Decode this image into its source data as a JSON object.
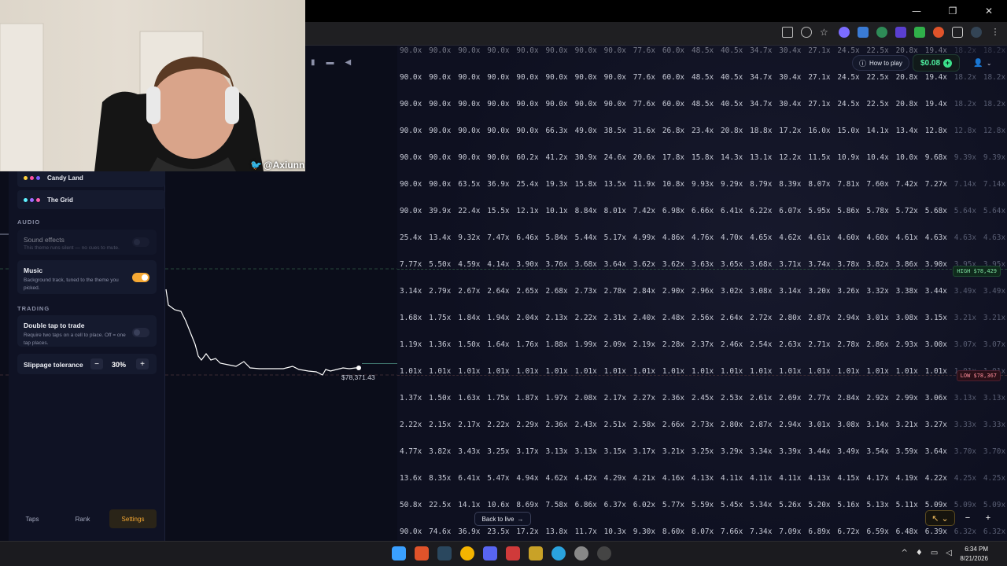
{
  "window": {
    "minimize": "—",
    "maximize": "❐",
    "close": "✕"
  },
  "header": {
    "how_to_play": "How to play",
    "balance": "$0.08",
    "balance_plus": "+"
  },
  "chart": {
    "price_label": "$78,371.43",
    "high_tag": "HIGH $78,429",
    "low_tag": "LOW $78,367"
  },
  "grid_rows": [
    [
      "90.0x",
      "90.0x",
      "90.0x",
      "90.0x",
      "90.0x",
      "90.0x",
      "90.0x",
      "90.0x",
      "77.6x",
      "60.0x",
      "48.5x",
      "40.5x",
      "34.7x",
      "30.4x",
      "27.1x",
      "24.5x",
      "22.5x",
      "20.8x",
      "19.4x",
      "18.2x",
      "18.2x",
      "18.2x"
    ],
    [
      "90.0x",
      "90.0x",
      "90.0x",
      "90.0x",
      "90.0x",
      "90.0x",
      "90.0x",
      "90.0x",
      "77.6x",
      "60.0x",
      "48.5x",
      "40.5x",
      "34.7x",
      "30.4x",
      "27.1x",
      "24.5x",
      "22.5x",
      "20.8x",
      "19.4x",
      "18.2x",
      "18.2x",
      "18.2x"
    ],
    [
      "90.0x",
      "90.0x",
      "90.0x",
      "90.0x",
      "90.0x",
      "90.0x",
      "90.0x",
      "90.0x",
      "77.6x",
      "60.0x",
      "48.5x",
      "40.5x",
      "34.7x",
      "30.4x",
      "27.1x",
      "24.5x",
      "22.5x",
      "20.8x",
      "19.4x",
      "18.2x",
      "18.2x",
      "18.2x"
    ],
    [
      "90.0x",
      "90.0x",
      "90.0x",
      "90.0x",
      "90.0x",
      "66.3x",
      "49.0x",
      "38.5x",
      "31.6x",
      "26.8x",
      "23.4x",
      "20.8x",
      "18.8x",
      "17.2x",
      "16.0x",
      "15.0x",
      "14.1x",
      "13.4x",
      "12.8x",
      "12.8x",
      "12.8x",
      "12.8x"
    ],
    [
      "90.0x",
      "90.0x",
      "90.0x",
      "90.0x",
      "60.2x",
      "41.2x",
      "30.9x",
      "24.6x",
      "20.6x",
      "17.8x",
      "15.8x",
      "14.3x",
      "13.1x",
      "12.2x",
      "11.5x",
      "10.9x",
      "10.4x",
      "10.0x",
      "9.68x",
      "9.39x",
      "9.39x",
      "9.39x"
    ],
    [
      "90.0x",
      "90.0x",
      "63.5x",
      "36.9x",
      "25.4x",
      "19.3x",
      "15.8x",
      "13.5x",
      "11.9x",
      "10.8x",
      "9.93x",
      "9.29x",
      "8.79x",
      "8.39x",
      "8.07x",
      "7.81x",
      "7.60x",
      "7.42x",
      "7.27x",
      "7.14x",
      "7.14x",
      "7.14x"
    ],
    [
      "90.0x",
      "39.9x",
      "22.4x",
      "15.5x",
      "12.1x",
      "10.1x",
      "8.84x",
      "8.01x",
      "7.42x",
      "6.98x",
      "6.66x",
      "6.41x",
      "6.22x",
      "6.07x",
      "5.95x",
      "5.86x",
      "5.78x",
      "5.72x",
      "5.68x",
      "5.64x",
      "5.64x",
      "5.64x"
    ],
    [
      "25.4x",
      "13.4x",
      "9.32x",
      "7.47x",
      "6.46x",
      "5.84x",
      "5.44x",
      "5.17x",
      "4.99x",
      "4.86x",
      "4.76x",
      "4.70x",
      "4.65x",
      "4.62x",
      "4.61x",
      "4.60x",
      "4.60x",
      "4.61x",
      "4.63x",
      "4.63x",
      "4.63x",
      "4.63x"
    ],
    [
      "7.77x",
      "5.50x",
      "4.59x",
      "4.14x",
      "3.90x",
      "3.76x",
      "3.68x",
      "3.64x",
      "3.62x",
      "3.62x",
      "3.63x",
      "3.65x",
      "3.68x",
      "3.71x",
      "3.74x",
      "3.78x",
      "3.82x",
      "3.86x",
      "3.90x",
      "3.95x",
      "3.95x",
      "3.95x"
    ],
    [
      "3.14x",
      "2.79x",
      "2.67x",
      "2.64x",
      "2.65x",
      "2.68x",
      "2.73x",
      "2.78x",
      "2.84x",
      "2.90x",
      "2.96x",
      "3.02x",
      "3.08x",
      "3.14x",
      "3.20x",
      "3.26x",
      "3.32x",
      "3.38x",
      "3.44x",
      "3.49x",
      "3.49x",
      "3.49x"
    ],
    [
      "1.68x",
      "1.75x",
      "1.84x",
      "1.94x",
      "2.04x",
      "2.13x",
      "2.22x",
      "2.31x",
      "2.40x",
      "2.48x",
      "2.56x",
      "2.64x",
      "2.72x",
      "2.80x",
      "2.87x",
      "2.94x",
      "3.01x",
      "3.08x",
      "3.15x",
      "3.21x",
      "3.21x",
      "3.21x"
    ],
    [
      "1.19x",
      "1.36x",
      "1.50x",
      "1.64x",
      "1.76x",
      "1.88x",
      "1.99x",
      "2.09x",
      "2.19x",
      "2.28x",
      "2.37x",
      "2.46x",
      "2.54x",
      "2.63x",
      "2.71x",
      "2.78x",
      "2.86x",
      "2.93x",
      "3.00x",
      "3.07x",
      "3.07x",
      "3.07x"
    ],
    [
      "1.01x",
      "1.01x",
      "1.01x",
      "1.01x",
      "1.01x",
      "1.01x",
      "1.01x",
      "1.01x",
      "1.01x",
      "1.01x",
      "1.01x",
      "1.01x",
      "1.01x",
      "1.01x",
      "1.01x",
      "1.01x",
      "1.01x",
      "1.01x",
      "1.01x",
      "1.01x",
      "1.01x",
      ""
    ],
    [
      "1.37x",
      "1.50x",
      "1.63x",
      "1.75x",
      "1.87x",
      "1.97x",
      "2.08x",
      "2.17x",
      "2.27x",
      "2.36x",
      "2.45x",
      "2.53x",
      "2.61x",
      "2.69x",
      "2.77x",
      "2.84x",
      "2.92x",
      "2.99x",
      "3.06x",
      "3.13x",
      "3.13x",
      "3.13x"
    ],
    [
      "2.22x",
      "2.15x",
      "2.17x",
      "2.22x",
      "2.29x",
      "2.36x",
      "2.43x",
      "2.51x",
      "2.58x",
      "2.66x",
      "2.73x",
      "2.80x",
      "2.87x",
      "2.94x",
      "3.01x",
      "3.08x",
      "3.14x",
      "3.21x",
      "3.27x",
      "3.33x",
      "3.33x",
      "3.33x"
    ],
    [
      "4.77x",
      "3.82x",
      "3.43x",
      "3.25x",
      "3.17x",
      "3.13x",
      "3.13x",
      "3.15x",
      "3.17x",
      "3.21x",
      "3.25x",
      "3.29x",
      "3.34x",
      "3.39x",
      "3.44x",
      "3.49x",
      "3.54x",
      "3.59x",
      "3.64x",
      "3.70x",
      "3.70x",
      "3.70x"
    ],
    [
      "13.6x",
      "8.35x",
      "6.41x",
      "5.47x",
      "4.94x",
      "4.62x",
      "4.42x",
      "4.29x",
      "4.21x",
      "4.16x",
      "4.13x",
      "4.11x",
      "4.11x",
      "4.11x",
      "4.13x",
      "4.15x",
      "4.17x",
      "4.19x",
      "4.22x",
      "4.25x",
      "4.25x",
      "4.25x"
    ],
    [
      "50.8x",
      "22.5x",
      "14.1x",
      "10.6x",
      "8.69x",
      "7.58x",
      "6.86x",
      "6.37x",
      "6.02x",
      "5.77x",
      "5.59x",
      "5.45x",
      "5.34x",
      "5.26x",
      "5.20x",
      "5.16x",
      "5.13x",
      "5.11x",
      "5.09x",
      "5.09x",
      "5.09x",
      "5.09x"
    ],
    [
      "90.0x",
      "74.6x",
      "36.9x",
      "23.5x",
      "17.2x",
      "13.8x",
      "11.7x",
      "10.3x",
      "9.30x",
      "8.60x",
      "8.07x",
      "7.66x",
      "7.34x",
      "7.09x",
      "6.89x",
      "6.72x",
      "6.59x",
      "6.48x",
      "6.39x",
      "6.32x",
      "6.32x",
      "6.32x"
    ]
  ],
  "panel": {
    "themes": [
      {
        "label": "Candy Land",
        "colors": [
          "#ffd23f",
          "#ff4fa0",
          "#7b5cff"
        ]
      },
      {
        "label": "The Grid",
        "colors": [
          "#5ff2ff",
          "#a06cff",
          "#ff5fb0"
        ]
      }
    ],
    "audio_label": "AUDIO",
    "sound_effects": {
      "title": "Sound effects",
      "desc": "This theme runs silent — no cues to mute."
    },
    "music": {
      "title": "Music",
      "desc": "Background track, tuned to the theme you picked."
    },
    "trading_label": "TRADING",
    "double_tap": {
      "title": "Double tap to trade",
      "desc": "Require two taps on a cell to place. Off = one tap places."
    },
    "slippage": {
      "title": "Slippage tolerance",
      "minus": "−",
      "value": "30%",
      "plus": "+"
    }
  },
  "bottom_tabs": {
    "taps": "Taps",
    "rank": "Rank",
    "settings": "Settings"
  },
  "back_to_live": "Back to live",
  "zoom": {
    "recenter": "↖ ⌄",
    "out": "−",
    "in": "+"
  },
  "webcam": {
    "handle": "@Axiunn"
  },
  "taskbar": {
    "time": "6:34 PM",
    "date": "8/21/2026"
  },
  "colors": {
    "accent": "#f5a833",
    "balance": "#4ef0a0",
    "high": "#7fe0a0",
    "low": "#ff8c9a"
  }
}
